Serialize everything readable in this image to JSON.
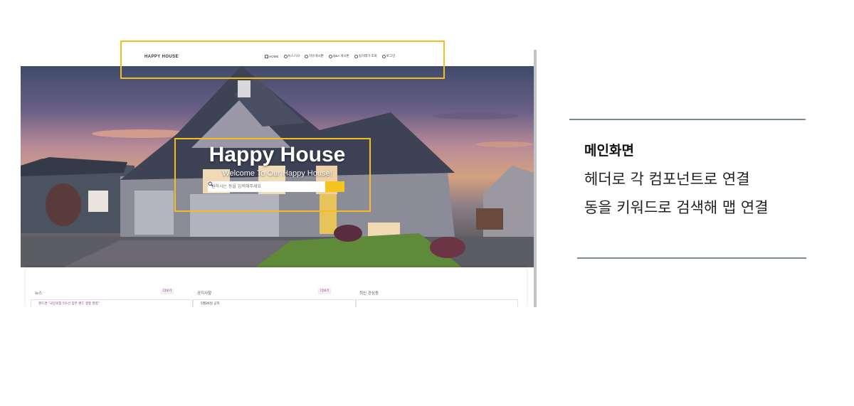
{
  "header": {
    "brand": "HAPPY HOUSE",
    "nav": [
      {
        "icon": "home-icon",
        "label": "HOME"
      },
      {
        "icon": "list-icon",
        "label": "뉴스기사"
      },
      {
        "icon": "chat-icon",
        "label": "자유게시판"
      },
      {
        "icon": "help-icon",
        "label": "Q&A 게시판"
      },
      {
        "icon": "pin-icon",
        "label": "실거래가 조회"
      },
      {
        "icon": "user-icon",
        "label": "로그인"
      }
    ]
  },
  "hero": {
    "title": "Happy House",
    "subtitle": "Welcome To Our Happy House!",
    "search_placeholder": "원하시는 동을 입력해주세요"
  },
  "cards": [
    {
      "title": "뉴스",
      "more": "더보기",
      "first_row": "랜드앤 \"국민의힘 5우선 집부 랜드 결정 말함\""
    },
    {
      "title": "공지사항",
      "more": "더보기",
      "first_row": "5월26일 공지"
    },
    {
      "title": "최신 관심동",
      "more": "",
      "first_row": ""
    }
  ],
  "note": {
    "title": "메인화면",
    "lines": [
      "헤더로 각 컴포넌트로 연결",
      "동을 키워드로 검색해 맵 연결"
    ]
  },
  "colors": {
    "highlight": "#f2bd1d",
    "search_button": "#f5c51e",
    "rule": "#7a8b94"
  }
}
